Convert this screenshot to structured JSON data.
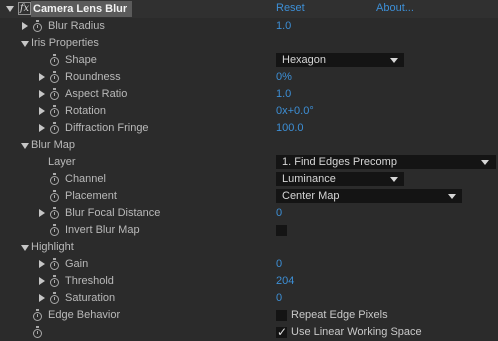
{
  "effect": {
    "fx_label": "fx",
    "title": "Camera Lens Blur",
    "reset": "Reset",
    "about": "About..."
  },
  "blur_radius": {
    "label": "Blur Radius",
    "value": "1.0"
  },
  "iris": {
    "label": "Iris Properties",
    "shape": {
      "label": "Shape",
      "value": "Hexagon"
    },
    "roundness": {
      "label": "Roundness",
      "value": "0%"
    },
    "aspect_ratio": {
      "label": "Aspect Ratio",
      "value": "1.0"
    },
    "rotation": {
      "label": "Rotation",
      "value": "0x+0.0°"
    },
    "diffraction": {
      "label": "Diffraction Fringe",
      "value": "100.0"
    }
  },
  "blur_map": {
    "label": "Blur Map",
    "layer": {
      "label": "Layer",
      "value": "1. Find Edges Precomp"
    },
    "channel": {
      "label": "Channel",
      "value": "Luminance"
    },
    "placement": {
      "label": "Placement",
      "value": "Center Map"
    },
    "focal_distance": {
      "label": "Blur Focal Distance",
      "value": "0"
    },
    "invert": {
      "label": "Invert Blur Map",
      "checked": false
    }
  },
  "highlight": {
    "label": "Highlight",
    "gain": {
      "label": "Gain",
      "value": "0"
    },
    "threshold": {
      "label": "Threshold",
      "value": "204"
    },
    "saturation": {
      "label": "Saturation",
      "value": "0"
    }
  },
  "edge_behavior": {
    "label": "Edge Behavior",
    "repeat_label": "Repeat Edge Pixels",
    "repeat_checked": false
  },
  "linear": {
    "label": "Use Linear Working Space",
    "checked": true
  }
}
